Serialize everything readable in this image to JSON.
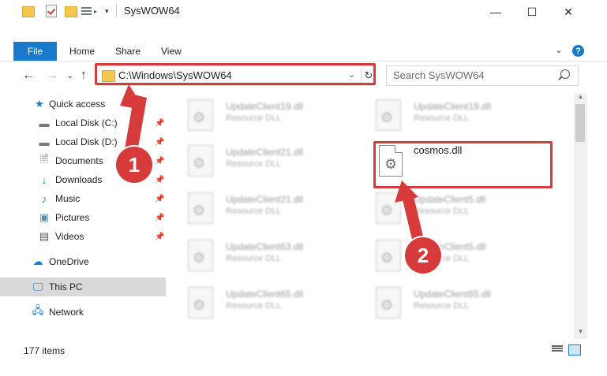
{
  "window": {
    "title": "SysWOW64",
    "minimize": "—",
    "maximize": "☐",
    "close": "✕"
  },
  "ribbon": {
    "tabs": [
      "File",
      "Home",
      "Share",
      "View"
    ],
    "expand": "⌄",
    "help": "?"
  },
  "navigation": {
    "back": "←",
    "forward": "→",
    "recent": "⌄",
    "up": "↑",
    "address": "C:\\Windows\\SysWOW64",
    "dropdown": "⌄",
    "refresh": "↻",
    "search_placeholder": "Search SysWOW64"
  },
  "sidebar": {
    "items": [
      {
        "label": "Quick access",
        "icon": "star-icon"
      },
      {
        "label": "Local Disk (C:)",
        "icon": "drive-icon"
      },
      {
        "label": "Local Disk (D:)",
        "icon": "drive-icon"
      },
      {
        "label": "Documents",
        "icon": "documents-icon"
      },
      {
        "label": "Downloads",
        "icon": "download-icon"
      },
      {
        "label": "Music",
        "icon": "music-icon"
      },
      {
        "label": "Pictures",
        "icon": "pictures-icon"
      },
      {
        "label": "Videos",
        "icon": "videos-icon"
      },
      {
        "label": "OneDrive",
        "icon": "cloud-icon"
      },
      {
        "label": "This PC",
        "icon": "computer-icon"
      },
      {
        "label": "Network",
        "icon": "network-icon"
      }
    ],
    "pin": "📌"
  },
  "files": [
    {
      "name": "UpdateClient19.dll",
      "type": "Resource DLL"
    },
    {
      "name": "UpdateClient19.dll",
      "type": "Resource DLL"
    },
    {
      "name": "UpdateClient21.dll",
      "type": "Resource DLL"
    },
    {
      "name": "cosmos.dll",
      "type": ""
    },
    {
      "name": "UpdateClient21.dll",
      "type": "Resource DLL"
    },
    {
      "name": "UpdateClient5.dll",
      "type": "Resource DLL"
    },
    {
      "name": "UpdateClient63.dll",
      "type": "Resource DLL"
    },
    {
      "name": "UpdateClient5.dll",
      "type": "Resource DLL"
    },
    {
      "name": "UpdateClient65.dll",
      "type": "Resource DLL"
    },
    {
      "name": "UpdateClient65.dll",
      "type": "Resource DLL"
    }
  ],
  "status": {
    "item_count": "177 items"
  },
  "callouts": [
    "1",
    "2"
  ],
  "colors": {
    "accent": "#1979ca",
    "highlight": "#d63a3a",
    "selected": "#d9d9d9"
  }
}
